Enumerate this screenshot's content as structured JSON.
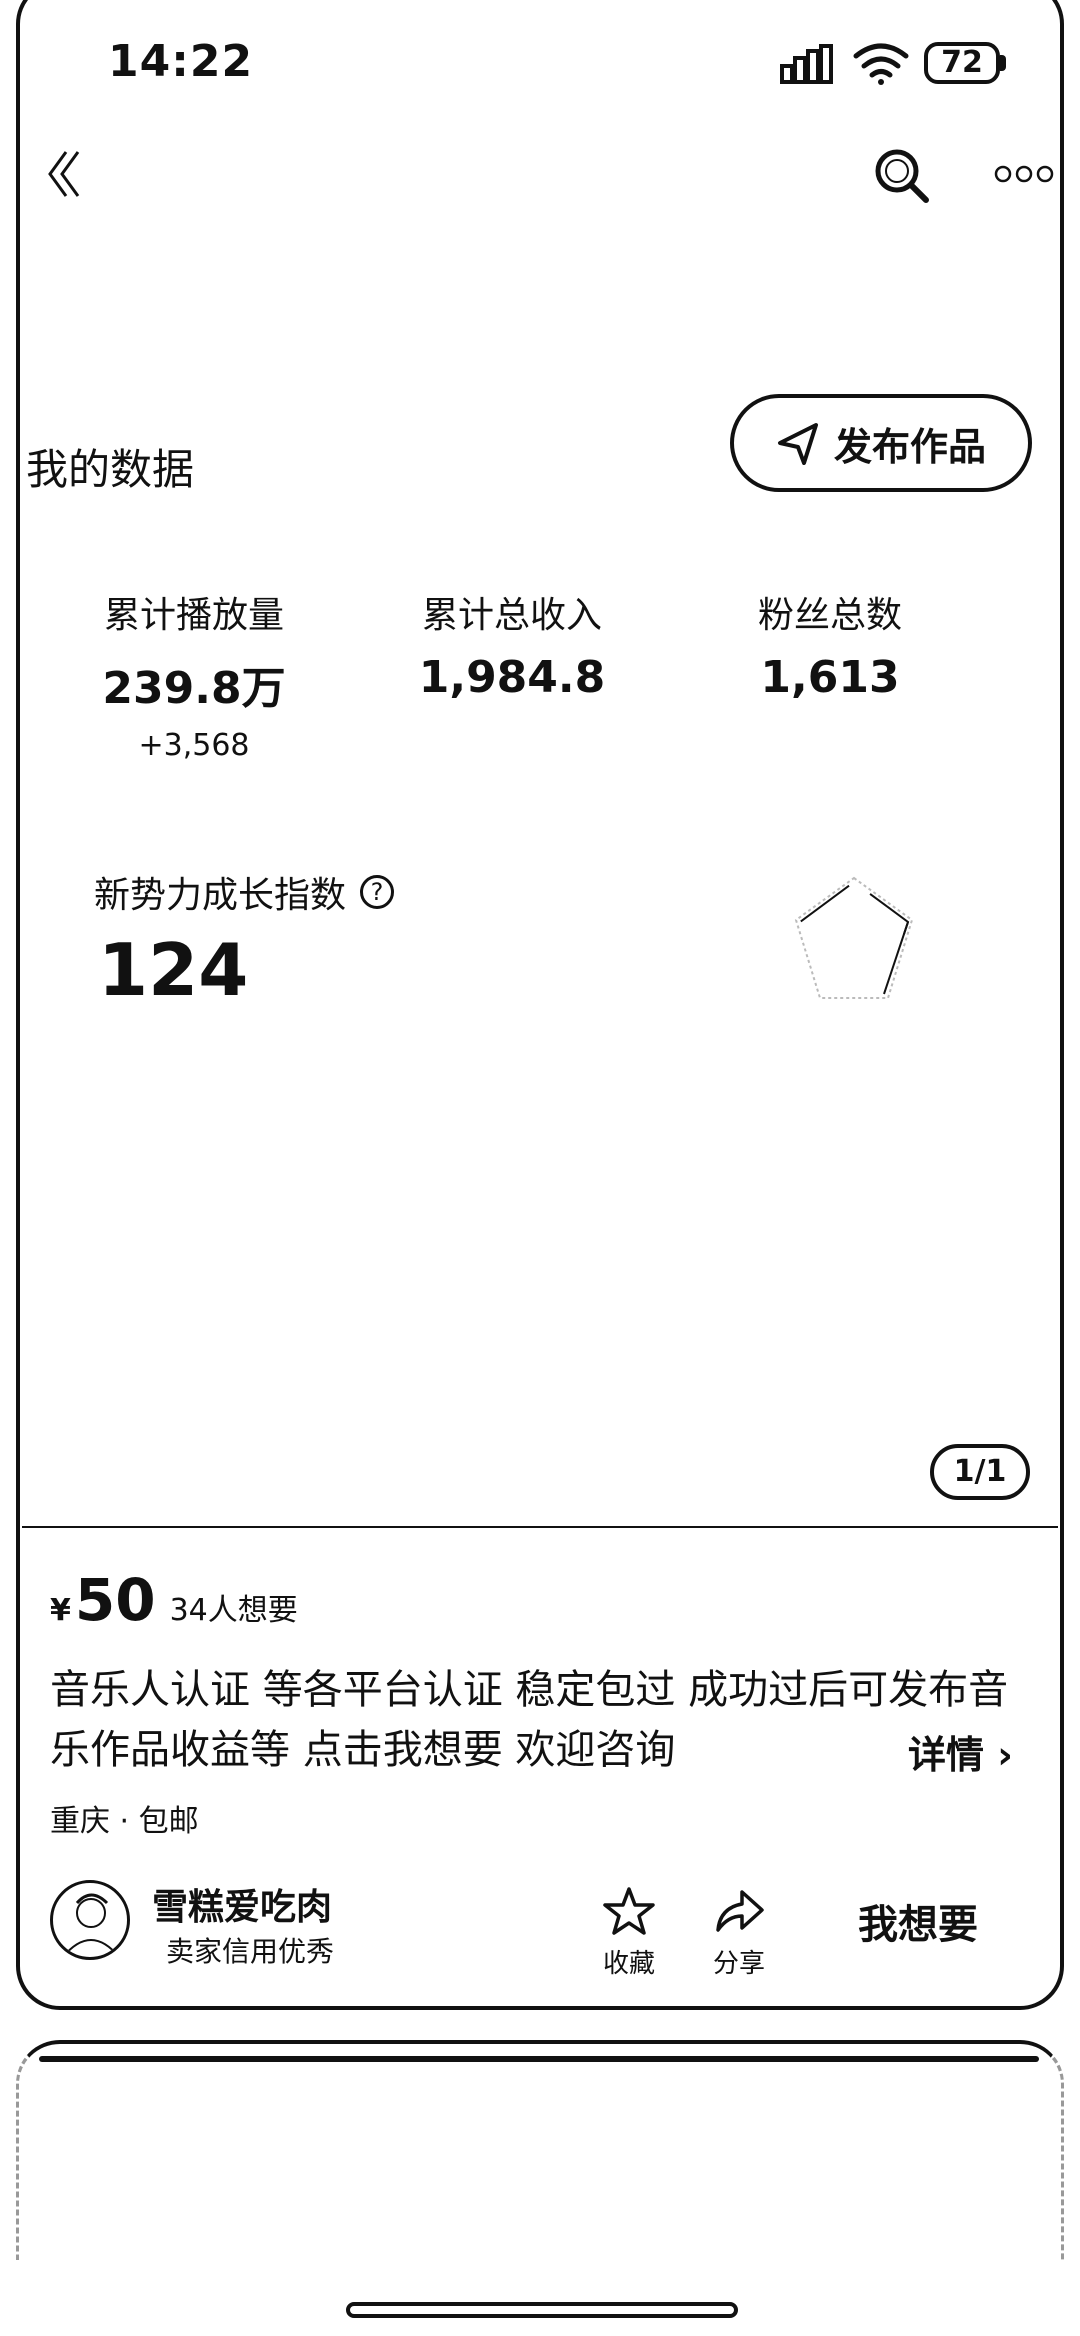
{
  "status_bar": {
    "time": "14:22",
    "battery": "72"
  },
  "data_section": {
    "title": "我的数据",
    "publish_button": "发布作品",
    "stats": [
      {
        "label": "累计播放量",
        "value": "239.8万",
        "delta": "+3,568"
      },
      {
        "label": "累计总收入",
        "value": "1,984.8"
      },
      {
        "label": "粉丝总数",
        "value": "1,613"
      }
    ],
    "growth_index": {
      "label": "新势力成长指数",
      "help": "?",
      "value": "124"
    }
  },
  "page_indicator": "1/1",
  "listing": {
    "currency": "¥",
    "price": "50",
    "wants": "34人想要",
    "description": "音乐人认证  等各平台认证 稳定包过 成功过后可发布音乐作品收益等 点击我想要 欢迎咨询",
    "details": "详情 ›",
    "location": "重庆 · 包邮",
    "seller": {
      "name": "雪糕爱吃肉",
      "badge": "卖家信用优秀"
    },
    "actions": {
      "favorite": "收藏",
      "share": "分享",
      "want": "我想要"
    }
  }
}
